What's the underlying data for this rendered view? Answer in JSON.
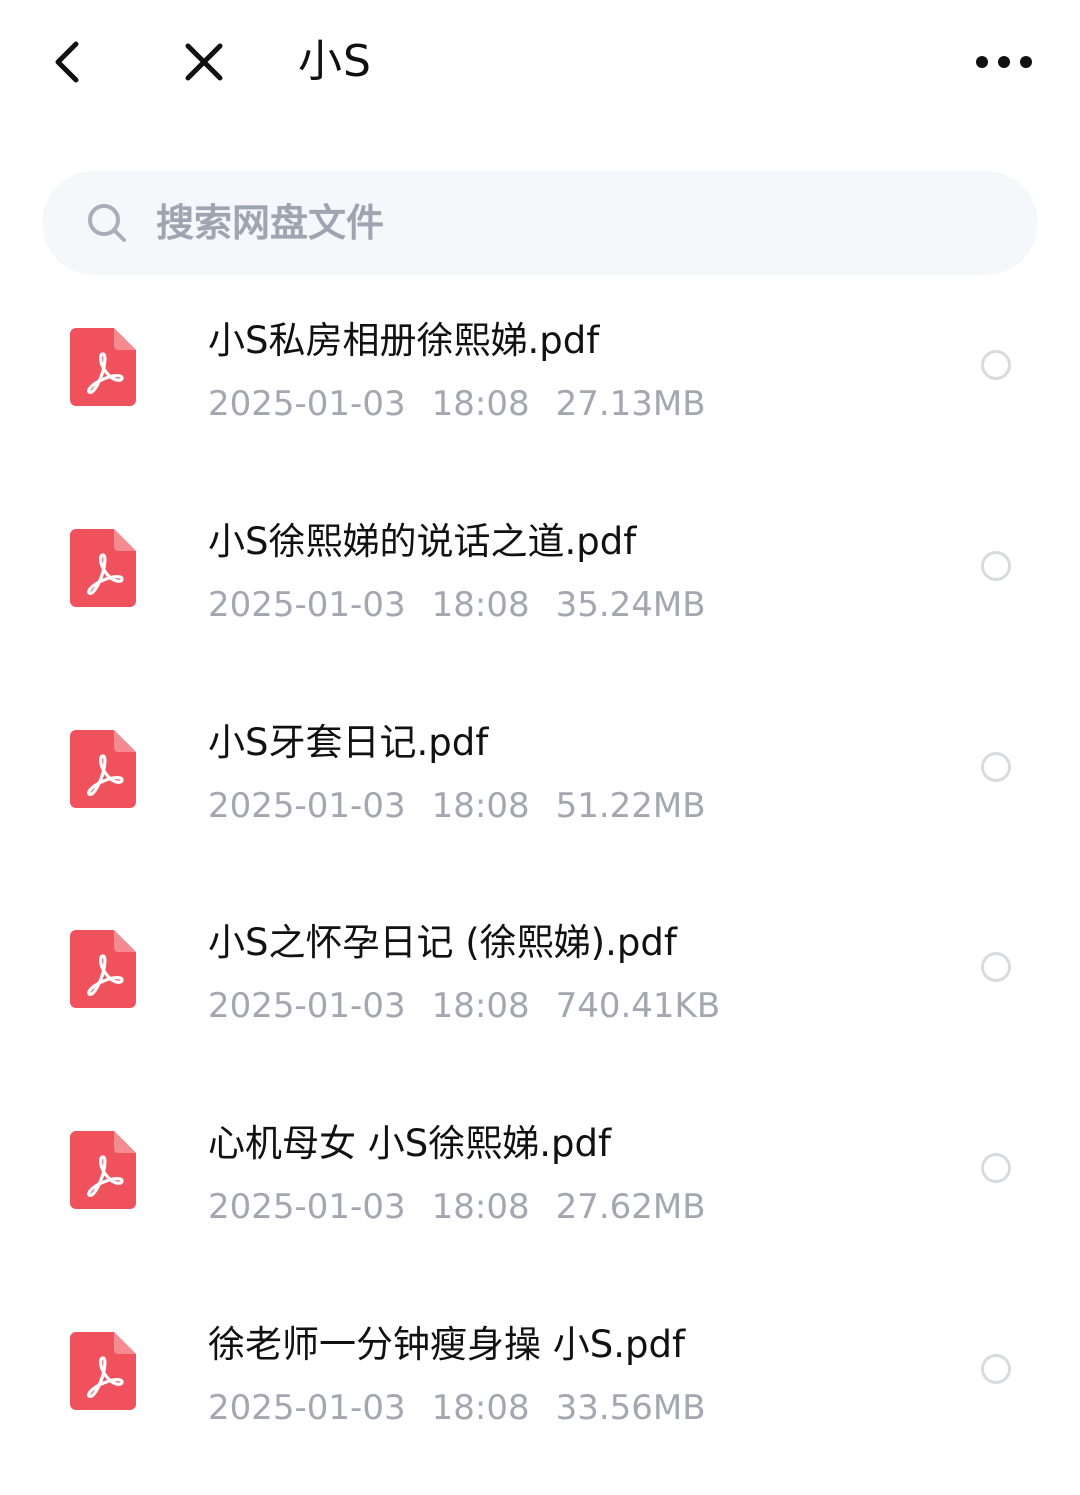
{
  "header": {
    "title": "小S",
    "back_icon": "chevron-left-icon",
    "close_icon": "close-icon",
    "more_icon": "more-horizontal-icon"
  },
  "search": {
    "placeholder": "搜索网盘文件",
    "icon": "search-icon"
  },
  "colors": {
    "pdf_icon": "#f0525d",
    "meta_text": "#a3a7b0",
    "search_bg": "#f6f7fb"
  },
  "files": [
    {
      "name": "小S私房相册徐熙娣.pdf",
      "date": "2025-01-03",
      "time": "18:08",
      "size": "27.13MB",
      "icon": "pdf-file-icon"
    },
    {
      "name": "小S徐熙娣的说话之道.pdf",
      "date": "2025-01-03",
      "time": "18:08",
      "size": "35.24MB",
      "icon": "pdf-file-icon"
    },
    {
      "name": "小S牙套日记.pdf",
      "date": "2025-01-03",
      "time": "18:08",
      "size": "51.22MB",
      "icon": "pdf-file-icon"
    },
    {
      "name": "小S之怀孕日记 (徐熙娣).pdf",
      "date": "2025-01-03",
      "time": "18:08",
      "size": "740.41KB",
      "icon": "pdf-file-icon"
    },
    {
      "name": "心机母女 小S徐熙娣.pdf",
      "date": "2025-01-03",
      "time": "18:08",
      "size": "27.62MB",
      "icon": "pdf-file-icon"
    },
    {
      "name": "徐老师一分钟瘦身操 小S.pdf",
      "date": "2025-01-03",
      "time": "18:08",
      "size": "33.56MB",
      "icon": "pdf-file-icon"
    }
  ]
}
